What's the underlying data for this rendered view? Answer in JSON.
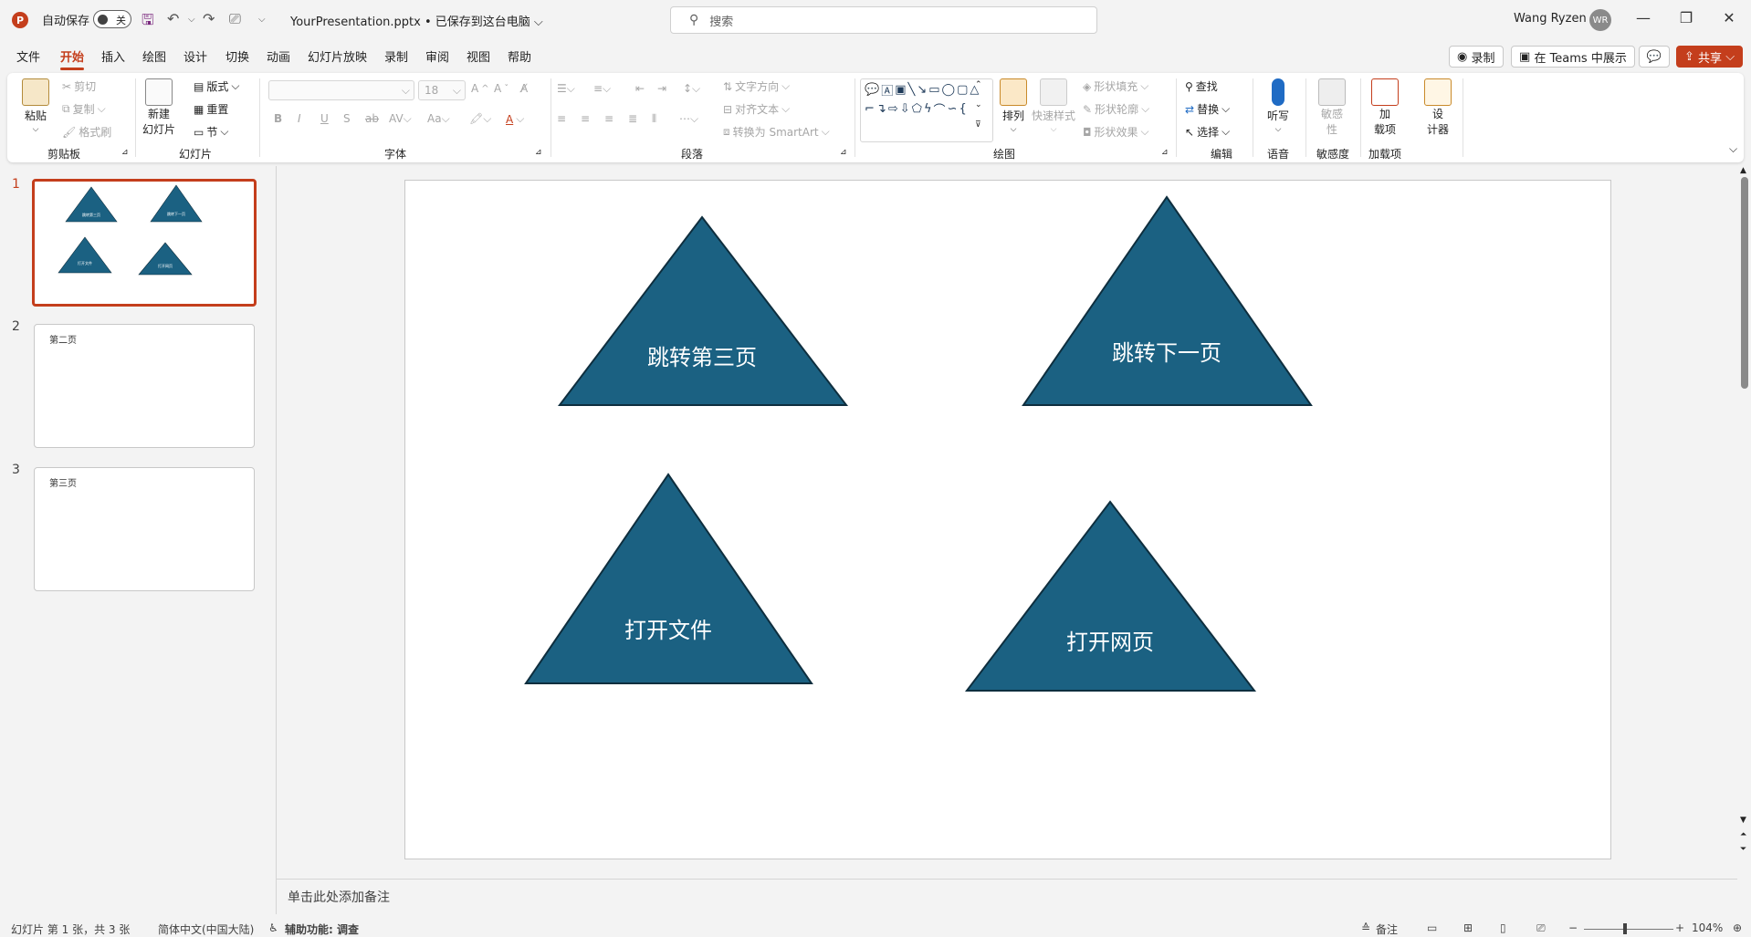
{
  "titlebar": {
    "app_icon": "P",
    "autosave_label": "自动保存",
    "autosave_state": "关",
    "filename": "YourPresentation.pptx • 已保存到这台电脑 ⌵",
    "search_placeholder": "搜索",
    "user_name": "Wang Ryzen",
    "user_initials": "WR",
    "minimize": "—",
    "restore": "❐",
    "close": "✕"
  },
  "menu": {
    "tabs": [
      "文件",
      "开始",
      "插入",
      "绘图",
      "设计",
      "切换",
      "动画",
      "幻灯片放映",
      "录制",
      "审阅",
      "视图",
      "帮助"
    ],
    "active_tab": "开始",
    "record_label": "录制",
    "teams_label": "在 Teams 中展示",
    "comment_icon": "💬",
    "share_label": "共享"
  },
  "ribbon": {
    "groups": {
      "clipboard": "剪贴板",
      "slides": "幻灯片",
      "font": "字体",
      "paragraph": "段落",
      "drawing": "绘图",
      "editing": "编辑",
      "voice": "语音",
      "sensitivity": "敏感度",
      "addins": "加载项"
    },
    "paste": "粘贴",
    "cut": "剪切",
    "copy": "复制",
    "format_painter": "格式刷",
    "new_slide": "新建",
    "new_slide_2": "幻灯片",
    "layout": "版式",
    "reset": "重置",
    "section": "节",
    "font_size": "18",
    "text_direction": "文字方向",
    "align_text": "对齐文本",
    "smartart": "转换为 SmartArt",
    "arrange": "排列",
    "quick_styles": "快速样式",
    "shape_fill": "形状填充",
    "shape_outline": "形状轮廓",
    "shape_effects": "形状效果",
    "find": "查找",
    "replace": "替换",
    "select": "选择",
    "dictate": "听写",
    "sensitivity_btn": "敏感",
    "sensitivity_btn_2": "性",
    "addins_btn": "加",
    "addins_btn_2": "载项",
    "designer_btn": "设",
    "designer_btn_2": "计器"
  },
  "thumbnails": [
    {
      "number": "1",
      "title": "",
      "shapes": [
        "跳转第三页",
        "跳转下一页",
        "打开文件",
        "打开网页"
      ]
    },
    {
      "number": "2",
      "title": "第二页"
    },
    {
      "number": "3",
      "title": "第三页"
    }
  ],
  "slide": {
    "shapes": [
      {
        "label": "跳转第三页",
        "action": "jump-third-page"
      },
      {
        "label": "跳转下一页",
        "action": "jump-next-page"
      },
      {
        "label": "打开文件",
        "action": "open-file"
      },
      {
        "label": "打开网页",
        "action": "open-webpage"
      }
    ],
    "fill_color": "#1b6182",
    "stroke_color": "#0e2e3e"
  },
  "notes_placeholder": "单击此处添加备注",
  "status": {
    "slide_info": "幻灯片 第 1 张，共 3 张",
    "language": "简体中文(中国大陆)",
    "accessibility": "辅助功能: 调查",
    "notes_btn": "备注",
    "zoom_level": "104%"
  }
}
